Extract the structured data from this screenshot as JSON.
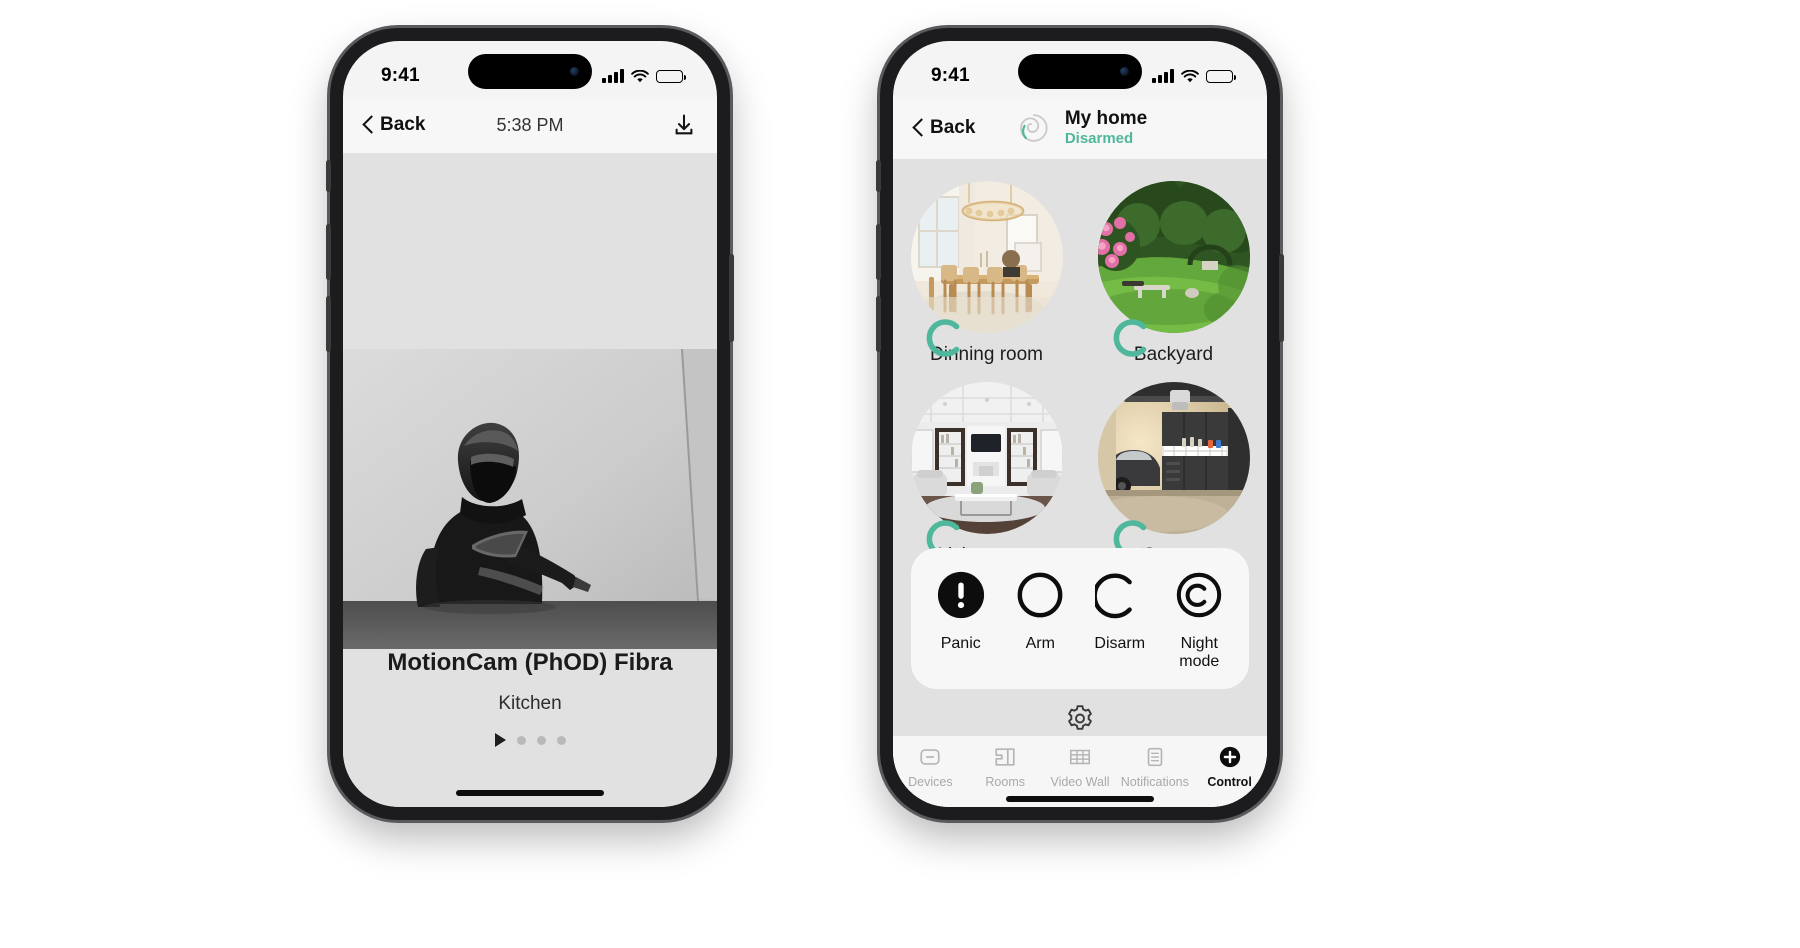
{
  "phone_left": {
    "status_bar": {
      "time": "9:41",
      "signal_icon": "cellular-signal-icon",
      "wifi_icon": "wifi-icon",
      "battery_icon": "battery-full-icon"
    },
    "nav": {
      "back_label": "Back",
      "back_icon": "chevron-left-icon",
      "title": "5:38 PM",
      "download_icon": "download-icon"
    },
    "event": {
      "image_alt": "security-camera-grayscale-frame",
      "device_name": "MotionCam (PhOD) Fibra",
      "room": "Kitchen"
    },
    "pager": {
      "play_icon": "play-triangle-icon",
      "dots": 3,
      "active_index": 0
    }
  },
  "phone_right": {
    "status_bar": {
      "time": "9:41",
      "signal_icon": "cellular-signal-icon",
      "wifi_icon": "wifi-icon",
      "battery_icon": "battery-full-icon"
    },
    "nav": {
      "back_label": "Back",
      "back_icon": "chevron-left-icon",
      "hub_icon": "spiral-hub-icon",
      "home_name": "My home",
      "home_state": "Disarmed"
    },
    "rooms": [
      {
        "label": "Dinning room",
        "image_alt": "dining-room-photo",
        "status_icon": "disarmed-arc-icon"
      },
      {
        "label": "Backyard",
        "image_alt": "backyard-garden-photo",
        "status_icon": "disarmed-arc-icon"
      },
      {
        "label": "Living room",
        "image_alt": "living-room-photo",
        "status_icon": "disarmed-arc-icon"
      },
      {
        "label": "Garage",
        "image_alt": "garage-interior-photo",
        "status_icon": "disarmed-arc-icon"
      }
    ],
    "controls": [
      {
        "label": "Panic",
        "icon": "panic-exclamation-icon",
        "style": "filled"
      },
      {
        "label": "Arm",
        "icon": "arm-circle-icon",
        "style": "outline"
      },
      {
        "label": "Disarm",
        "icon": "disarm-open-circle-icon",
        "style": "outline"
      },
      {
        "label": "Night mode",
        "icon": "night-mode-double-circle-icon",
        "style": "outline"
      }
    ],
    "settings_icon": "gear-icon",
    "tabs": [
      {
        "label": "Devices",
        "icon": "device-minus-icon",
        "active": false
      },
      {
        "label": "Rooms",
        "icon": "floorplan-icon",
        "active": false
      },
      {
        "label": "Video Wall",
        "icon": "grid-icon",
        "active": false
      },
      {
        "label": "Notifications",
        "icon": "document-lines-icon",
        "active": false
      },
      {
        "label": "Control",
        "icon": "plus-circle-filled-icon",
        "active": true
      }
    ]
  },
  "theme": {
    "accent_green": "#4fb79b",
    "body_gray": "#e1e1e1",
    "card_white": "#f7f7f7",
    "text_dark": "#111111",
    "tab_inactive": "#a9a9a9"
  }
}
